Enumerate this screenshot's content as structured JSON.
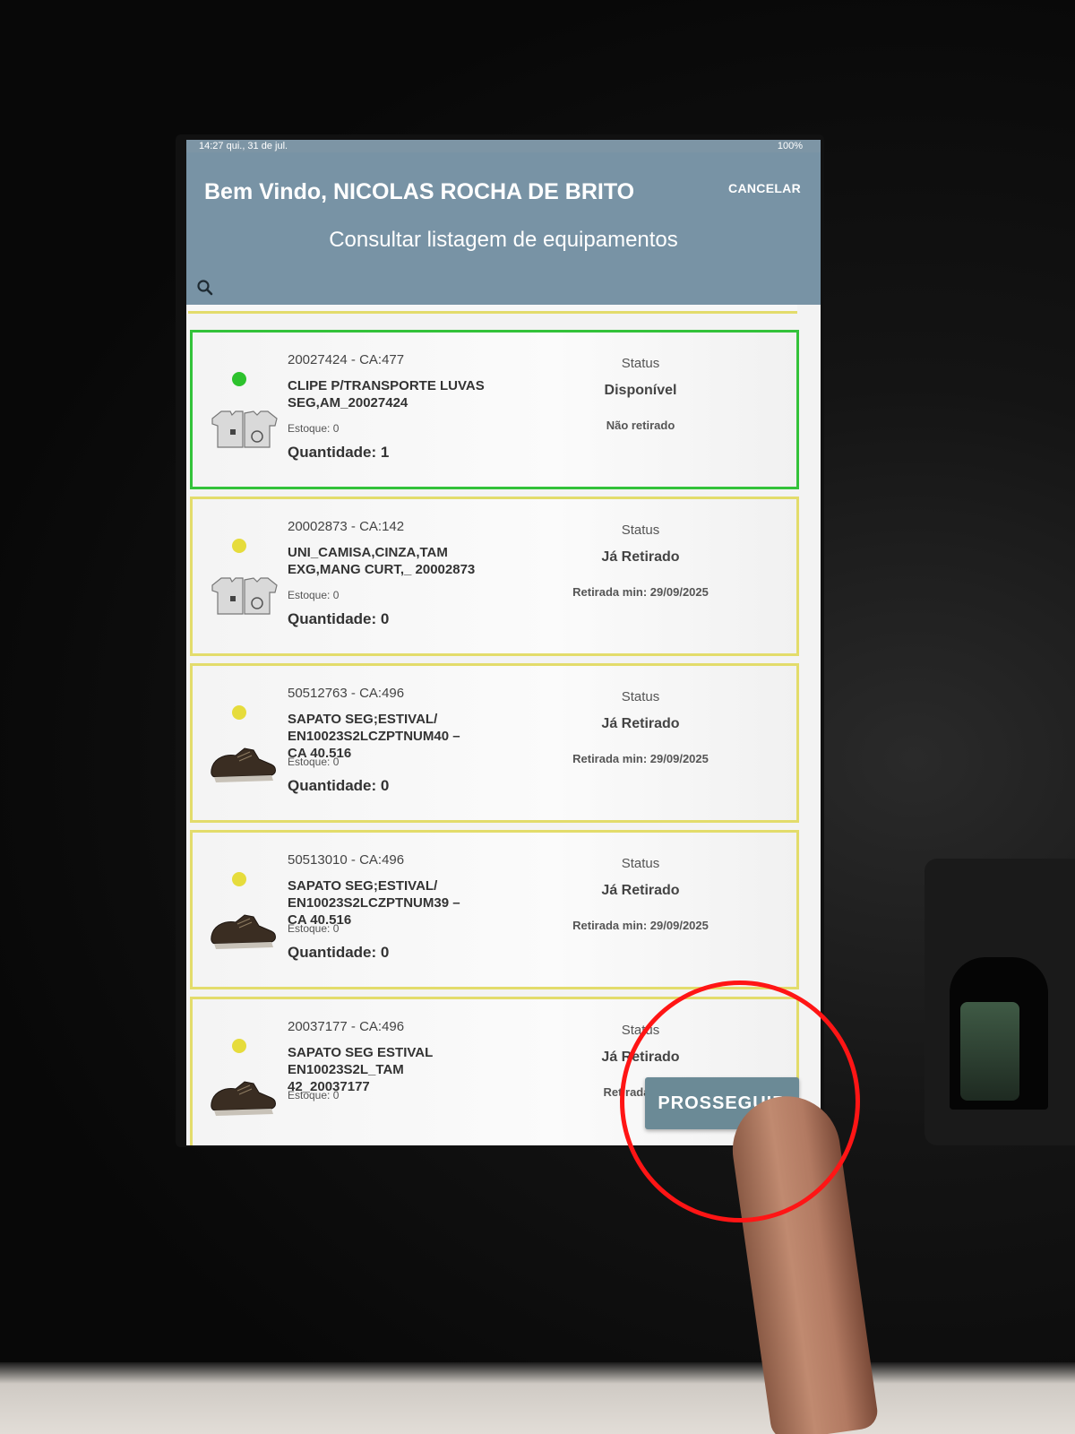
{
  "statusbar": {
    "left": "14:27 qui., 31 de jul.",
    "right": "100%"
  },
  "header": {
    "welcome": "Bem Vindo, NICOLAS  ROCHA DE BRITO",
    "cancel_label": "CANCELAR",
    "title": "Consultar listagem de equipamentos"
  },
  "items": [
    {
      "code": "20027424 - CA:477",
      "name": "CLIPE P/TRANSPORTE LUVAS\nSEG,AM_20027424",
      "estoque": "Estoque: 0",
      "quantidade": "Quantidade: 1",
      "status_label": "Status",
      "status_value": "Disponível",
      "status_note": "Não retirado",
      "dot_color": "#2dc22d",
      "selected": true,
      "thumb": "shirt-thumbnail"
    },
    {
      "code": "20002873 - CA:142",
      "name": "UNI_CAMISA,CINZA,TAM\nEXG,MANG CURT,_ 20002873",
      "estoque": "Estoque: 0",
      "quantidade": "Quantidade: 0",
      "status_label": "Status",
      "status_value": "Já Retirado",
      "status_note": "Retirada min: 29/09/2025",
      "dot_color": "#e6dc3c",
      "selected": false,
      "thumb": "shirt-thumbnail"
    },
    {
      "code": "50512763 - CA:496",
      "name": "SAPATO SEG;ESTIVAL/\nEN10023S2LCZPTNUM40 –\nCA 40.516",
      "estoque": "Estoque: 0",
      "quantidade": "Quantidade: 0",
      "status_label": "Status",
      "status_value": "Já Retirado",
      "status_note": "Retirada min: 29/09/2025",
      "dot_color": "#e6dc3c",
      "selected": false,
      "thumb": "shoe-thumbnail"
    },
    {
      "code": "50513010 - CA:496",
      "name": "SAPATO SEG;ESTIVAL/\nEN10023S2LCZPTNUM39 –\nCA 40.516",
      "estoque": "Estoque: 0",
      "quantidade": "Quantidade: 0",
      "status_label": "Status",
      "status_value": "Já Retirado",
      "status_note": "Retirada min: 29/09/2025",
      "dot_color": "#e6dc3c",
      "selected": false,
      "thumb": "shoe-thumbnail"
    },
    {
      "code": "20037177 - CA:496",
      "name": "SAPATO SEG ESTIVAL\nEN10023S2L_TAM\n42_20037177",
      "estoque": "Estoque: 0",
      "quantidade": "",
      "status_label": "Status",
      "status_value": "Já Retirado",
      "status_note": "Retirada min:",
      "dot_color": "#e6dc3c",
      "selected": false,
      "thumb": "shoe-thumbnail"
    }
  ],
  "proceed_label": "PROSSEGUIR",
  "icons": {
    "search": "search-icon"
  },
  "colors": {
    "header": "#7893a5",
    "selected_border": "#33c23a",
    "card_border": "#e3dc6b",
    "button": "#6b8a96",
    "annotation_ring": "#ff1515"
  }
}
